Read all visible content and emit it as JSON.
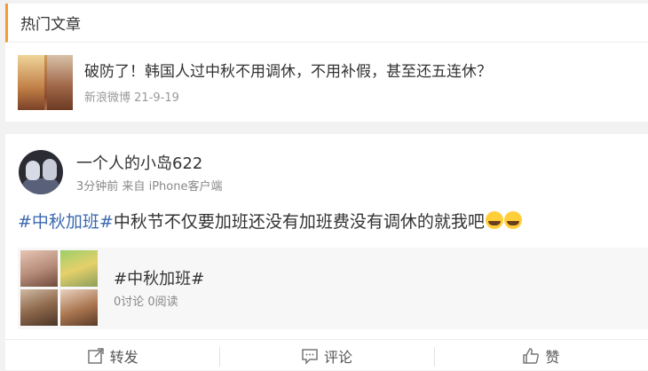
{
  "hot_articles": {
    "header": "热门文章",
    "article": {
      "title": "破防了！韩国人过中秋不用调休，不用补假，甚至还五连休？",
      "source": "新浪微博",
      "date": "21-9-19"
    }
  },
  "post": {
    "username": "一个人的小岛622",
    "time": "3分钟前",
    "from_prefix": "来自",
    "device": "iPhone客户端",
    "hashtag": "#中秋加班#",
    "body": "中秋节不仅要加班还没有加班费没有调休的就我吧",
    "emoji": [
      "crying-face-icon",
      "crying-face-icon"
    ],
    "topic": {
      "title": "#中秋加班#",
      "stats": "0讨论 0阅读"
    },
    "actions": {
      "repost": "转发",
      "comment": "评论",
      "like": "赞"
    }
  },
  "colors": {
    "accent": "#f29b38",
    "hashtag": "#3c68b0",
    "background": "#f2f2f2"
  }
}
